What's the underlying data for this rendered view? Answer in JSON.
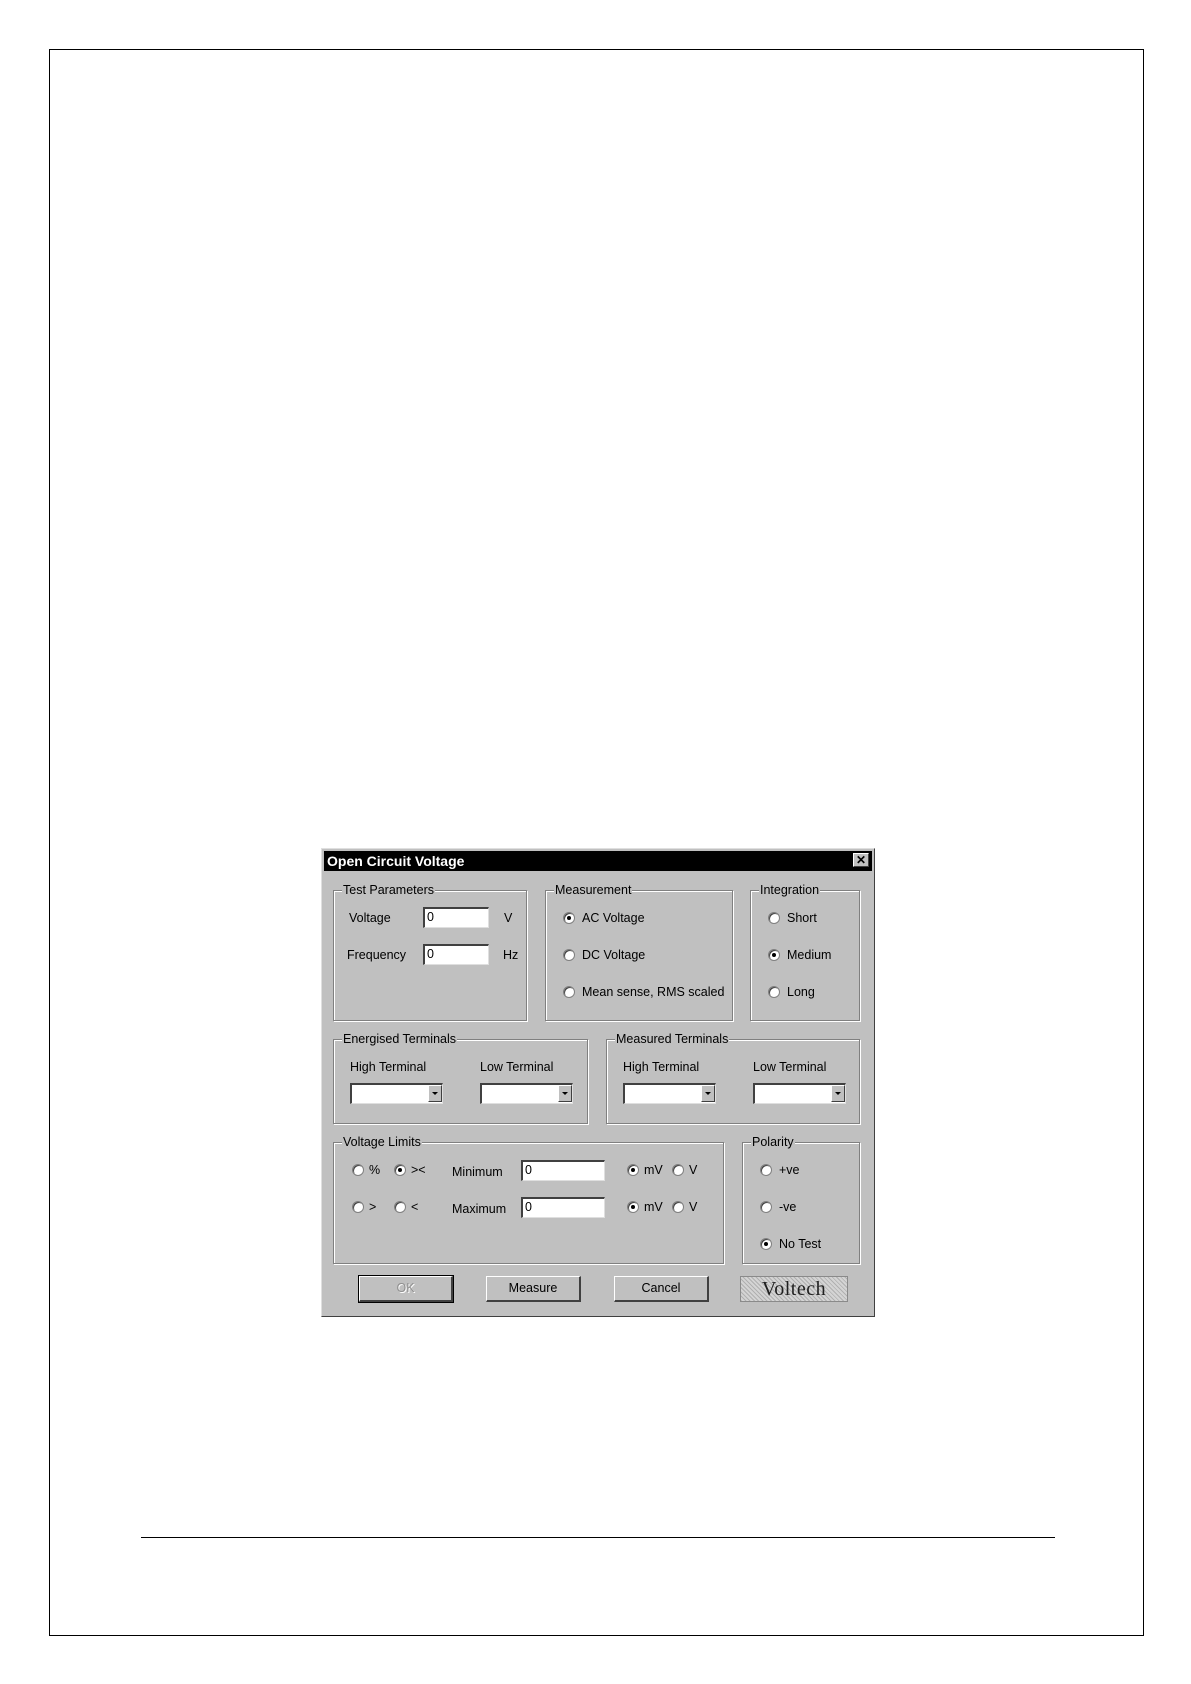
{
  "dialog": {
    "title": "Open Circuit Voltage",
    "close_glyph": "✕",
    "test_parameters": {
      "label": "Test Parameters",
      "voltage_label": "Voltage",
      "voltage_value": "0",
      "voltage_unit": "V",
      "frequency_label": "Frequency",
      "frequency_value": "0",
      "frequency_unit": "Hz"
    },
    "measurement": {
      "label": "Measurement",
      "options": [
        "AC Voltage",
        "DC Voltage",
        "Mean sense, RMS scaled"
      ],
      "selected": "AC Voltage"
    },
    "integration": {
      "label": "Integration",
      "options": [
        "Short",
        "Medium",
        "Long"
      ],
      "selected": "Medium"
    },
    "energised_terminals": {
      "label": "Energised Terminals",
      "high_label": "High Terminal",
      "low_label": "Low Terminal",
      "high_value": "",
      "low_value": ""
    },
    "measured_terminals": {
      "label": "Measured Terminals",
      "high_label": "High Terminal",
      "low_label": "Low Terminal",
      "high_value": "",
      "low_value": ""
    },
    "voltage_limits": {
      "label": "Voltage Limits",
      "mode_options": [
        "%",
        "><",
        ">",
        "<"
      ],
      "mode_selected": "><",
      "minimum_label": "Minimum",
      "minimum_value": "0",
      "minimum_unit_options": [
        "mV",
        "V"
      ],
      "minimum_unit_selected": "mV",
      "maximum_label": "Maximum",
      "maximum_value": "0",
      "maximum_unit_options": [
        "mV",
        "V"
      ],
      "maximum_unit_selected": "mV"
    },
    "polarity": {
      "label": "Polarity",
      "options": [
        "+ve",
        "-ve",
        "No Test"
      ],
      "selected": "No Test"
    },
    "buttons": {
      "ok": "OK",
      "measure": "Measure",
      "cancel": "Cancel"
    },
    "logo_text": "Voltech"
  }
}
